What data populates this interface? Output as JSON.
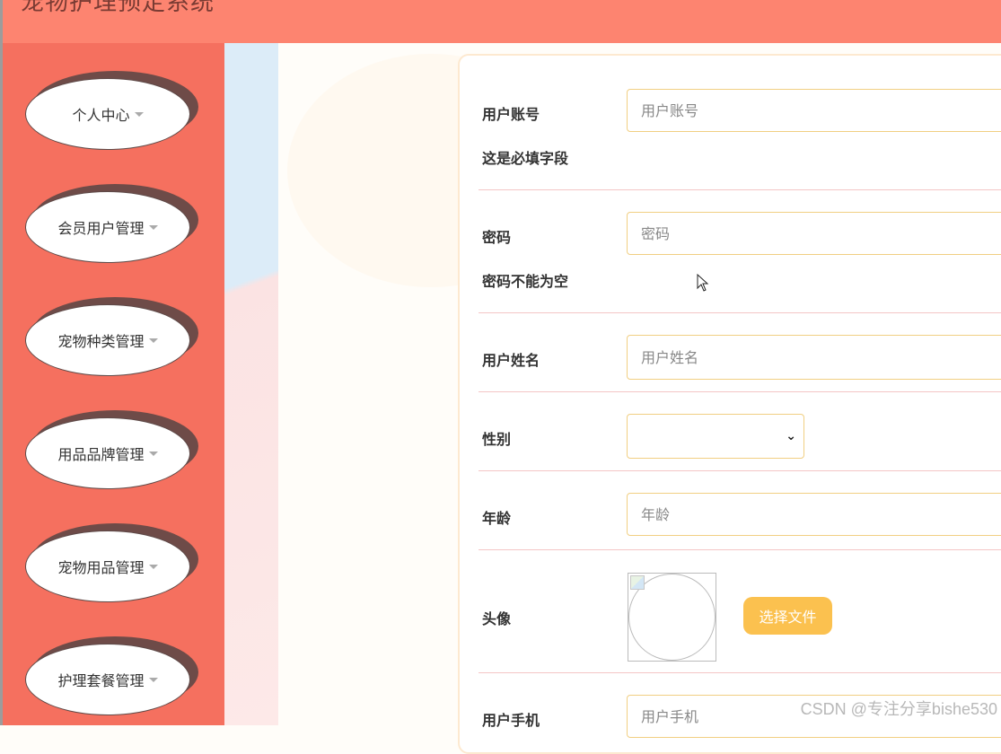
{
  "header": {
    "title": "宠物护理预定系统"
  },
  "sidebar": {
    "items": [
      {
        "label": "个人中心"
      },
      {
        "label": "会员用户管理"
      },
      {
        "label": "宠物种类管理"
      },
      {
        "label": "用品品牌管理"
      },
      {
        "label": "宠物用品管理"
      },
      {
        "label": "护理套餐管理"
      }
    ]
  },
  "form": {
    "account": {
      "label": "用户账号",
      "placeholder": "用户账号",
      "hint": "这是必填字段"
    },
    "password": {
      "label": "密码",
      "placeholder": "密码",
      "hint": "密码不能为空"
    },
    "name": {
      "label": "用户姓名",
      "placeholder": "用户姓名"
    },
    "gender": {
      "label": "性别",
      "value": ""
    },
    "age": {
      "label": "年龄",
      "placeholder": "年龄"
    },
    "avatar": {
      "label": "头像",
      "upload_label": "选择文件"
    },
    "phone": {
      "label": "用户手机",
      "placeholder": "用户手机"
    }
  },
  "watermark": "CSDN @专注分享bishe530",
  "colors": {
    "header": "#fd8470",
    "sidebar": "#f5705f",
    "input_border": "#f1cf82",
    "upload_button": "#fbc14f",
    "row_divider": "#f4c6c6"
  },
  "icons": {
    "menu_caret": "caret-down-icon",
    "select_chevron": "chevron-down-icon",
    "cursor": "mouse-pointer-icon"
  }
}
